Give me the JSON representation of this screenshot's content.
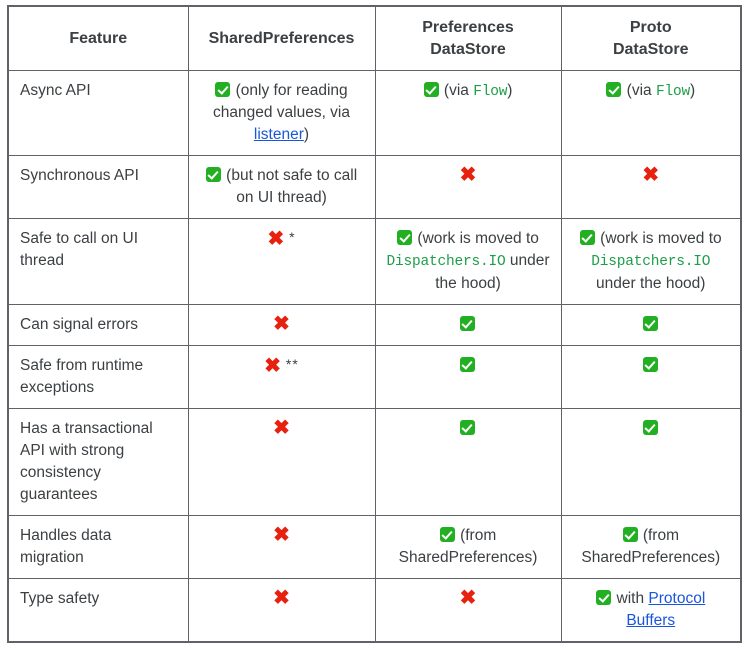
{
  "table": {
    "headers": [
      {
        "label": "Feature"
      },
      {
        "label": "SharedPreferences"
      },
      {
        "label": "Preferences\nDataStore",
        "line1": "Preferences",
        "line2": "DataStore"
      },
      {
        "label": "Proto\nDataStore",
        "line1": "Proto",
        "line2": "DataStore"
      }
    ],
    "rows": [
      {
        "feature": "Async API",
        "sharedprefs": {
          "mark": "check",
          "text_before": "(only for reading changed values, via ",
          "link": "listener",
          "text_after": ")"
        },
        "prefs_datastore": {
          "mark": "check",
          "text_before": "(via ",
          "code": "Flow",
          "text_after": ")"
        },
        "proto_datastore": {
          "mark": "check",
          "text_before": "(via ",
          "code": "Flow",
          "text_after": ")"
        }
      },
      {
        "feature": "Synchronous API",
        "sharedprefs": {
          "mark": "check",
          "text_before": "(but not safe to call on UI thread)"
        },
        "prefs_datastore": {
          "mark": "cross"
        },
        "proto_datastore": {
          "mark": "cross"
        }
      },
      {
        "feature": "Safe to call on UI thread",
        "sharedprefs": {
          "mark": "cross",
          "note": "*"
        },
        "prefs_datastore": {
          "mark": "check",
          "text_before": "(work is moved to ",
          "code": "Dispatchers.IO",
          "text_after": " under the hood)"
        },
        "proto_datastore": {
          "mark": "check",
          "text_before": "(work is moved to ",
          "code": "Dispatchers.IO",
          "text_after": " under the hood)"
        }
      },
      {
        "feature": "Can signal errors",
        "sharedprefs": {
          "mark": "cross"
        },
        "prefs_datastore": {
          "mark": "check"
        },
        "proto_datastore": {
          "mark": "check"
        }
      },
      {
        "feature": "Safe from runtime exceptions",
        "sharedprefs": {
          "mark": "cross",
          "note": "**"
        },
        "prefs_datastore": {
          "mark": "check"
        },
        "proto_datastore": {
          "mark": "check"
        }
      },
      {
        "feature": "Has a transactional API with strong consistency guarantees",
        "sharedprefs": {
          "mark": "cross"
        },
        "prefs_datastore": {
          "mark": "check"
        },
        "proto_datastore": {
          "mark": "check"
        }
      },
      {
        "feature": "Handles data migration",
        "sharedprefs": {
          "mark": "cross"
        },
        "prefs_datastore": {
          "mark": "check",
          "text_before": "(from SharedPreferences)"
        },
        "proto_datastore": {
          "mark": "check",
          "text_before": "(from SharedPreferences)"
        }
      },
      {
        "feature": "Type safety",
        "sharedprefs": {
          "mark": "cross"
        },
        "prefs_datastore": {
          "mark": "cross"
        },
        "proto_datastore": {
          "mark": "check",
          "text_before": "with ",
          "link": "Protocol Buffers"
        }
      }
    ]
  },
  "glyphs": {
    "check_icon": "check-mark-icon",
    "cross_icon": "cross-mark-icon",
    "cross_char": "✖"
  },
  "colors": {
    "check_green": "#22b022",
    "cross_red": "#e8210f",
    "link_blue": "#1a56db",
    "code_green": "#1e9e4a",
    "border": "#5f6368",
    "text": "#3c4043"
  }
}
